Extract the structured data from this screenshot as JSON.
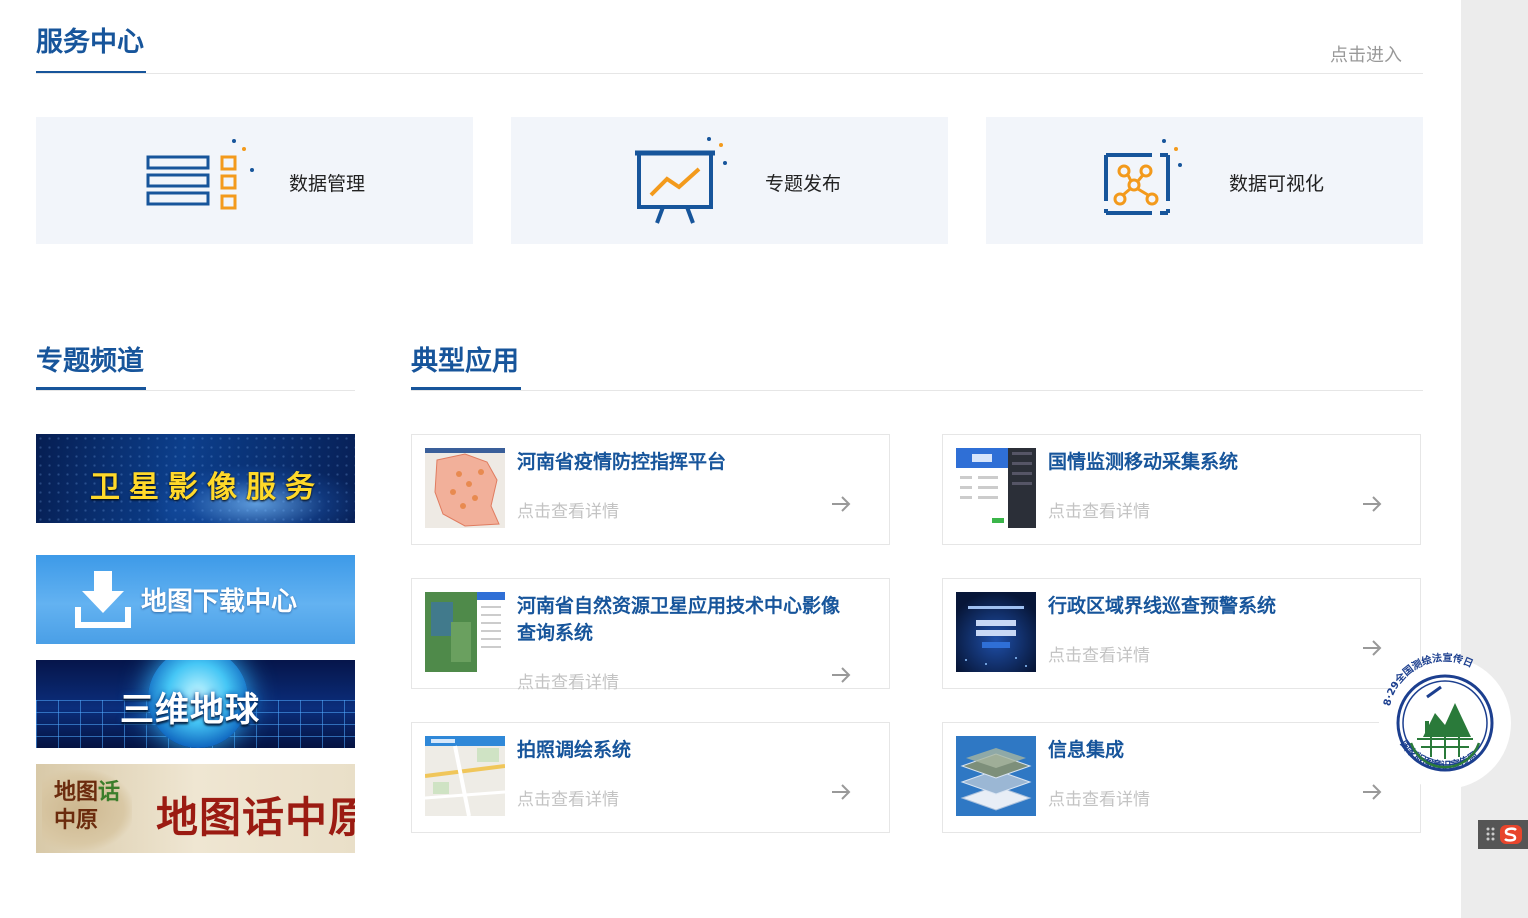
{
  "service": {
    "title": "服务中心",
    "enter": "点击进入",
    "cards": [
      {
        "label": "数据管理",
        "icon": "data-management-icon"
      },
      {
        "label": "专题发布",
        "icon": "presentation-chart-icon"
      },
      {
        "label": "数据可视化",
        "icon": "network-visualization-icon"
      }
    ]
  },
  "channels": {
    "title": "专题频道",
    "banners": [
      {
        "label": "卫星影像服务"
      },
      {
        "label": "地图下载中心"
      },
      {
        "label": "三维地球"
      },
      {
        "small_a": "地图",
        "small_b": "话",
        "small_c": "中原",
        "label": "地图话中原"
      }
    ]
  },
  "apps": {
    "title": "典型应用",
    "detail_label": "点击查看详情",
    "items": [
      {
        "title": "河南省疫情防控指挥平台"
      },
      {
        "title": "国情监测移动采集系统"
      },
      {
        "title": "河南省自然资源卫星应用技术中心影像查询系统"
      },
      {
        "title": "行政区域界线巡查预警系统"
      },
      {
        "title": "拍照调绘系统"
      },
      {
        "title": "信息集成"
      }
    ]
  },
  "seal": {
    "text_top": "8·29全国测绘法宣传日",
    "text_bottom": "国家版图意识宣传周"
  },
  "colors": {
    "brand": "#17559b",
    "accent": "#f39a1c",
    "card_bg": "#f2f5fa"
  }
}
